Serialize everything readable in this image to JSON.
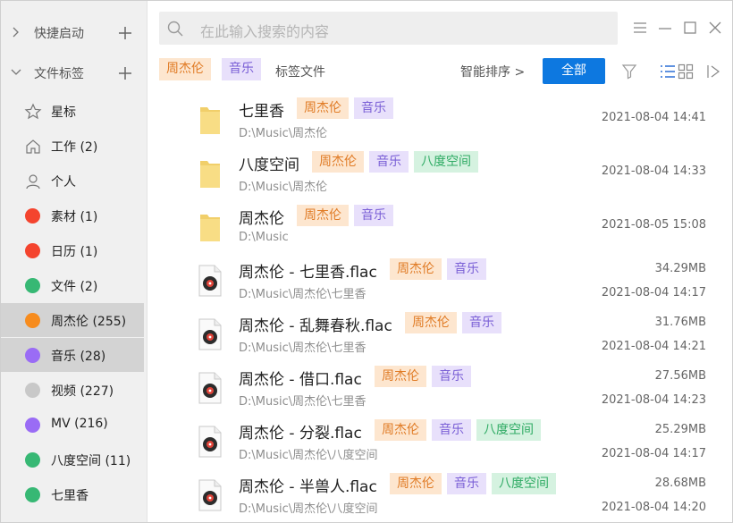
{
  "sidebar": {
    "sections": [
      {
        "label": "快捷启动",
        "expanded": false
      },
      {
        "label": "文件标签",
        "expanded": true
      }
    ],
    "items": [
      {
        "label": "星标",
        "icon": "star-icon"
      },
      {
        "label": "工作 (2)",
        "icon": "home-icon"
      },
      {
        "label": "个人",
        "icon": "person-icon"
      },
      {
        "label": "素材 (1)",
        "color": "#f4442e"
      },
      {
        "label": "日历 (1)",
        "color": "#f4442e"
      },
      {
        "label": "文件 (2)",
        "color": "#37b874"
      },
      {
        "label": "周杰伦 (255)",
        "color": "#f78c1e",
        "selected": true
      },
      {
        "label": "音乐 (28)",
        "color": "#9a6cf5",
        "selected": true
      },
      {
        "label": "视频 (227)",
        "color": "#c8c8c8"
      },
      {
        "label": "MV (216)",
        "color": "#9a6cf5"
      },
      {
        "label": "八度空间 (11)",
        "color": "#37b874"
      },
      {
        "label": "七里香",
        "color": "#37b874"
      }
    ]
  },
  "search": {
    "placeholder": "在此输入搜索的内容"
  },
  "filter": {
    "active_tags": [
      "周杰伦",
      "音乐"
    ],
    "label": "标签文件",
    "sort_label": "智能排序 >",
    "all_button": "全部"
  },
  "files": [
    {
      "type": "folder",
      "name": "七里香",
      "tags": [
        "周杰伦",
        "音乐"
      ],
      "path": "D:\\Music\\周杰伦",
      "size": "",
      "date": "2021-08-04 14:41"
    },
    {
      "type": "folder",
      "name": "八度空间",
      "tags": [
        "周杰伦",
        "音乐",
        "八度空间"
      ],
      "path": "D:\\Music\\周杰伦",
      "size": "",
      "date": "2021-08-04 14:33"
    },
    {
      "type": "folder",
      "name": "周杰伦",
      "tags": [
        "周杰伦",
        "音乐"
      ],
      "path": "D:\\Music",
      "size": "",
      "date": "2021-08-05 15:08"
    },
    {
      "type": "file",
      "name": "周杰伦 - 七里香.flac",
      "tags": [
        "周杰伦",
        "音乐"
      ],
      "path": "D:\\Music\\周杰伦\\七里香",
      "size": "34.29MB",
      "date": "2021-08-04 14:17"
    },
    {
      "type": "file",
      "name": "周杰伦 - 乱舞春秋.flac",
      "tags": [
        "周杰伦",
        "音乐"
      ],
      "path": "D:\\Music\\周杰伦\\七里香",
      "size": "31.76MB",
      "date": "2021-08-04 14:21"
    },
    {
      "type": "file",
      "name": "周杰伦 - 借口.flac",
      "tags": [
        "周杰伦",
        "音乐"
      ],
      "path": "D:\\Music\\周杰伦\\七里香",
      "size": "27.56MB",
      "date": "2021-08-04 14:23"
    },
    {
      "type": "file",
      "name": "周杰伦 - 分裂.flac",
      "tags": [
        "周杰伦",
        "音乐",
        "八度空间"
      ],
      "path": "D:\\Music\\周杰伦\\八度空间",
      "size": "25.29MB",
      "date": "2021-08-04 14:17"
    },
    {
      "type": "file",
      "name": "周杰伦 - 半兽人.flac",
      "tags": [
        "周杰伦",
        "音乐",
        "八度空间"
      ],
      "path": "D:\\Music\\周杰伦\\八度空间",
      "size": "28.68MB",
      "date": "2021-08-04 14:20"
    }
  ],
  "tag_colors": {
    "周杰伦": "orange",
    "音乐": "purple",
    "八度空间": "green"
  }
}
